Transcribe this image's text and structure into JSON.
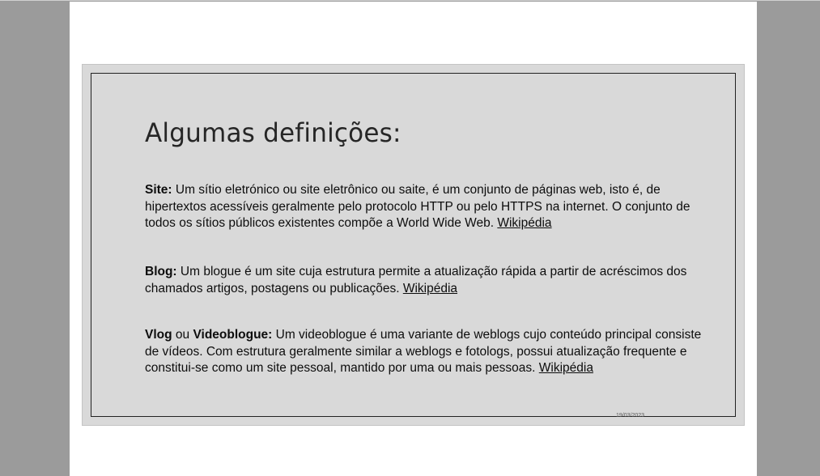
{
  "slide": {
    "title": "Algumas definições:",
    "definitions": [
      {
        "term": "Site:",
        "text": " Um sítio eletrónico ou site eletrônico ou saite, é um conjunto de páginas web, isto é, de hipertextos acessíveis geralmente pelo protocolo HTTP ou pelo HTTPS na internet. O conjunto de todos os sítios públicos existentes compõe a World Wide Web. ",
        "link": "Wikipédia"
      },
      {
        "term": "Blog:",
        "text": " Um blogue é um site cuja estrutura permite a atualização rápida a partir de acréscimos dos chamados artigos, postagens ou publicações. ",
        "link": "Wikipédia"
      },
      {
        "term": "Vlog",
        "connector": " ou ",
        "term2": "Videoblogue:",
        "text": " Um videoblogue é uma variante de weblogs cujo conteúdo principal consiste de vídeos. Com estrutura geralmente similar a weblogs e fotologs, possui atualização frequente e constitui-se como um site pessoal, mantido por uma ou mais pessoas. ",
        "link": "Wikipédia"
      }
    ],
    "date": "19/03/2023"
  }
}
